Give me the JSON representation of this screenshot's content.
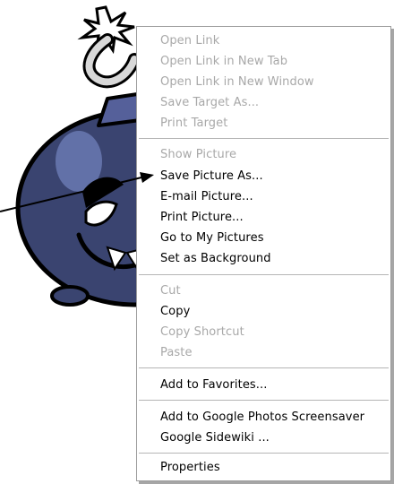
{
  "colors": {
    "bomb_body": "#3a4470",
    "bomb_highlight": "#6a79b2",
    "outline": "#000000",
    "menu_background": "#ffffff",
    "disabled_text": "#a8a8a8"
  },
  "context_menu": {
    "items": [
      {
        "id": "open-link",
        "label": "Open Link",
        "enabled": false
      },
      {
        "id": "open-link-new-tab",
        "label": "Open Link in New Tab",
        "enabled": false
      },
      {
        "id": "open-link-new-window",
        "label": "Open Link in New Window",
        "enabled": false
      },
      {
        "id": "save-target-as",
        "label": "Save Target As...",
        "enabled": false
      },
      {
        "id": "print-target",
        "label": "Print Target",
        "enabled": false
      },
      {
        "id": "show-picture",
        "label": "Show Picture",
        "enabled": false
      },
      {
        "id": "save-picture-as",
        "label": "Save Picture As...",
        "enabled": true
      },
      {
        "id": "email-picture",
        "label": "E-mail Picture...",
        "enabled": true
      },
      {
        "id": "print-picture",
        "label": "Print Picture...",
        "enabled": true
      },
      {
        "id": "go-to-my-pictures",
        "label": "Go to My Pictures",
        "enabled": true
      },
      {
        "id": "set-as-background",
        "label": "Set as Background",
        "enabled": true
      },
      {
        "id": "cut",
        "label": "Cut",
        "enabled": false
      },
      {
        "id": "copy",
        "label": "Copy",
        "enabled": true
      },
      {
        "id": "copy-shortcut",
        "label": "Copy Shortcut",
        "enabled": false
      },
      {
        "id": "paste",
        "label": "Paste",
        "enabled": false
      },
      {
        "id": "add-to-favorites",
        "label": "Add to Favorites...",
        "enabled": true
      },
      {
        "id": "add-to-google-photos",
        "label": "Add to Google Photos Screensaver",
        "enabled": true
      },
      {
        "id": "google-sidewiki",
        "label": "Google Sidewiki ...",
        "enabled": true
      },
      {
        "id": "properties",
        "label": "Properties",
        "enabled": true
      }
    ]
  }
}
